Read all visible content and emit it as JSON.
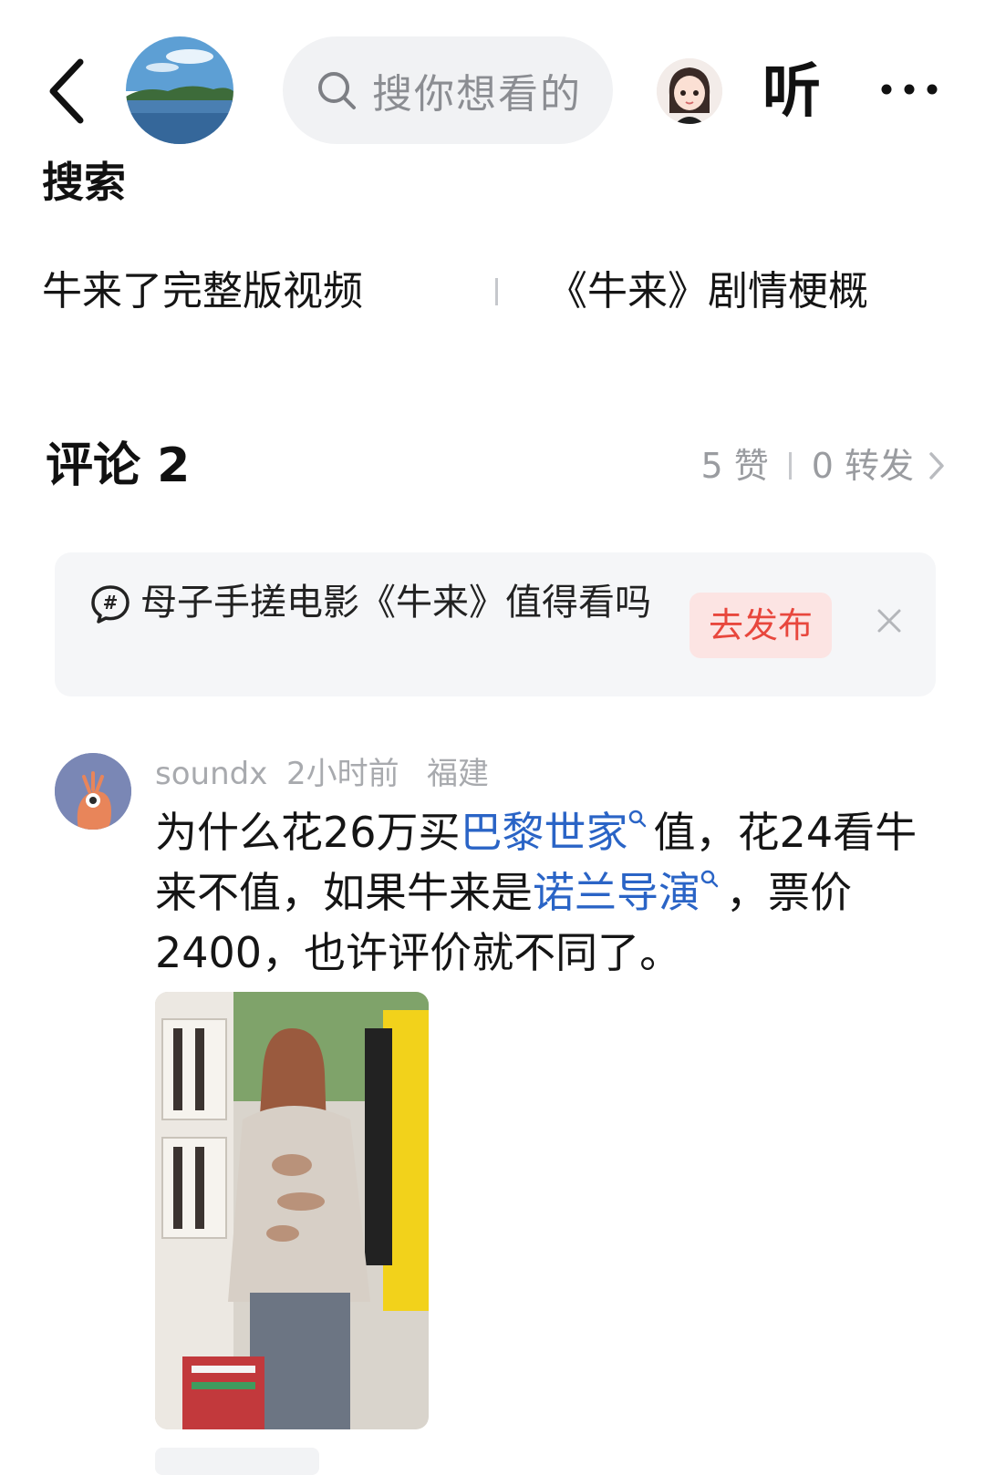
{
  "header": {
    "back_icon": "chevron-left-icon",
    "search_placeholder": "搜你想看的",
    "listen_label": "听",
    "more_icon": "more-horizontal-icon"
  },
  "search_section": {
    "heading": "搜索",
    "related": [
      "牛来了完整版视频",
      "《牛来》剧情梗概"
    ]
  },
  "comments": {
    "title": "评论 2",
    "likes": "5 赞",
    "reposts": "0 转发"
  },
  "topic_card": {
    "text": "母子手搓电影《牛来》值得看吗",
    "publish_label": "去发布"
  },
  "comment": {
    "user": "soundx",
    "time": "2小时前",
    "location": "福建",
    "body_1": "为什么花26万买",
    "link_1": "巴黎世家",
    "body_2": "值，花24看牛来不值，如果牛来是",
    "link_2": "诺兰导演",
    "body_3": "，票价2400，也许评价就不同了。"
  },
  "colors": {
    "link": "#2a64c6",
    "publish_bg": "#fce4e3",
    "publish_text": "#e8473d",
    "muted": "#9a9ca0"
  }
}
